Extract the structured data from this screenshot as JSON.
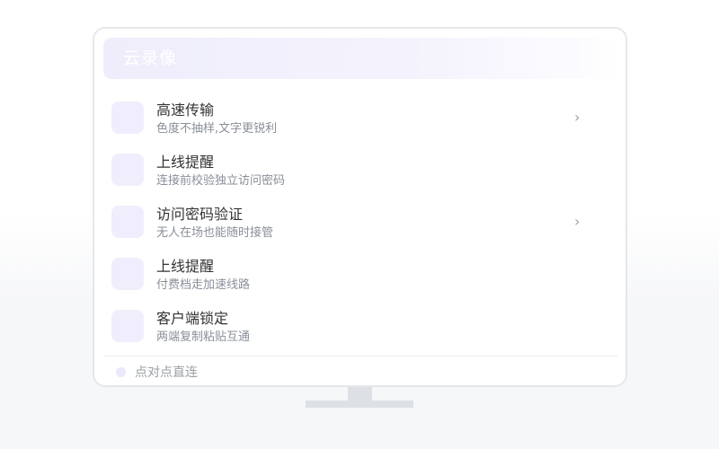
{
  "header": {
    "title": "云录像"
  },
  "items": [
    {
      "title": "高速传输",
      "subtitle": "色度不抽样,文字更锐利",
      "chevron": "›",
      "icon": "feature-icon"
    },
    {
      "title": "上线提醒",
      "subtitle": "连接前校验独立访问密码",
      "chevron": "",
      "icon": "feature-icon"
    },
    {
      "title": "访问密码验证",
      "subtitle": "无人在场也能随时接管",
      "chevron": "›",
      "icon": "feature-icon"
    },
    {
      "title": "上线提醒",
      "subtitle": "付费档走加速线路",
      "chevron": "",
      "icon": "feature-icon"
    },
    {
      "title": "客户端锁定",
      "subtitle": "两端复制粘贴互通",
      "chevron": "",
      "icon": "feature-icon"
    }
  ],
  "footer": {
    "text": "点对点直连"
  },
  "colors": {
    "accent_light": "#f0eefc",
    "title_text": "#333333",
    "subtitle_text": "#8a8f99",
    "border": "#e6e7ea",
    "stand": "#dde1e6"
  }
}
